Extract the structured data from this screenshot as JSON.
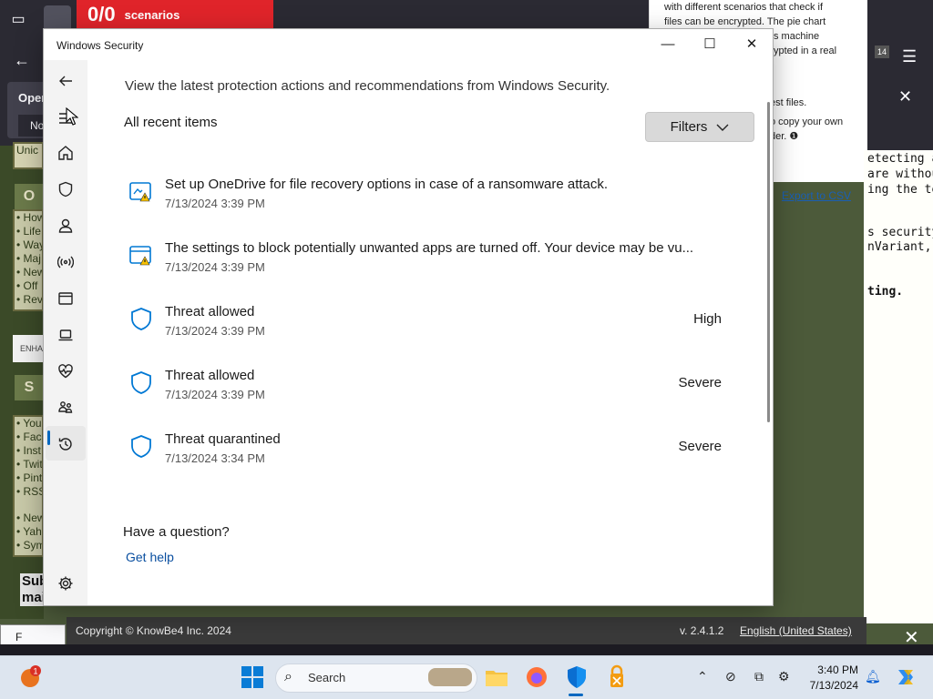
{
  "browser": {
    "score_value": "0/0",
    "score_label": "scenarios",
    "notification_title": "Oper",
    "notification_button": "No"
  },
  "article": {
    "text_lines": [
      "with different scenarios that check if",
      "files can be encrypted. The pie chart",
      "s machine",
      "ypted in a real"
    ],
    "text2_lines": [
      "est files.",
      "o copy your own",
      "der."
    ],
    "export_csv": "Export to CSV",
    "tab_badge": "14"
  },
  "right_panel": {
    "lines": [
      "etecting ar",
      "are withou",
      "ing the tes",
      "",
      "s security",
      "nVariant, I",
      "",
      "ting."
    ]
  },
  "left_site": {
    "box1_title": "O",
    "box1_items": [
      "• How",
      "• Life",
      "• Way",
      "• Maj",
      "• New",
      "• Off",
      "• Rev"
    ],
    "enhance_text": "ENHA",
    "box2_title": "S",
    "box2_items": [
      "• You",
      "• Fac",
      "• Inst",
      "• Twit",
      "• Pint",
      "• RSS",
      "",
      "• New",
      "• Yah",
      "• Sym"
    ],
    "sub_text": "Sub mai",
    "top_text": "Unic Syst"
  },
  "knowbe4": {
    "copyright": "Copyright © KnowBe4 Inc. 2024",
    "version": "v. 2.4.1.2",
    "language": "English (United States)",
    "find_text": "F"
  },
  "window": {
    "title": "Windows Security",
    "subtitle": "View the latest protection actions and recommendations from Windows Security.",
    "section_title": "All recent items",
    "filters_label": "Filters",
    "items": [
      {
        "title": "Set up OneDrive for file recovery options in case of a ransomware attack.",
        "time": "7/13/2024 3:39 PM",
        "severity": "",
        "icon": "onedrive-warning-icon"
      },
      {
        "title": "The settings to block potentially unwanted apps are turned off. Your device may be vu...",
        "time": "7/13/2024 3:39 PM",
        "severity": "",
        "icon": "app-warning-icon"
      },
      {
        "title": "Threat allowed",
        "time": "7/13/2024 3:39 PM",
        "severity": "High",
        "icon": "shield-icon"
      },
      {
        "title": "Threat allowed",
        "time": "7/13/2024 3:39 PM",
        "severity": "Severe",
        "icon": "shield-icon"
      },
      {
        "title": "Threat quarantined",
        "time": "7/13/2024 3:34 PM",
        "severity": "Severe",
        "icon": "shield-icon"
      }
    ],
    "question": "Have a question?",
    "get_help": "Get help"
  },
  "taskbar": {
    "search_text": "Search",
    "time": "3:40 PM",
    "date": "7/13/2024",
    "notification_count": "1"
  },
  "colors": {
    "accent": "#0067c0",
    "shield_blue": "#0078d4",
    "warning_yellow": "#f7c100",
    "score_red": "#e0242a"
  }
}
